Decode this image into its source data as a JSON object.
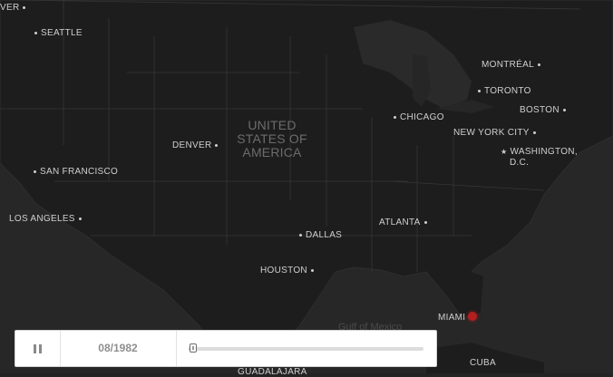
{
  "map": {
    "country_label": [
      "UNITED",
      "STATES OF",
      "AMERICA"
    ],
    "water_label": "Gulf of Mexico",
    "cities": [
      {
        "name": "VER",
        "marker": "dot"
      },
      {
        "name": "SEATTLE",
        "marker": "dot"
      },
      {
        "name": "MONTRÉAL",
        "marker": "dot"
      },
      {
        "name": "TORONTO",
        "marker": "dot"
      },
      {
        "name": "BOSTON",
        "marker": "dot"
      },
      {
        "name": "CHICAGO",
        "marker": "dot"
      },
      {
        "name": "NEW YORK CITY",
        "marker": "dot"
      },
      {
        "name": "WASHINGTON,",
        "marker": "star"
      },
      {
        "name": "D.C.",
        "marker": "none"
      },
      {
        "name": "DENVER",
        "marker": "dot"
      },
      {
        "name": "SAN FRANCISCO",
        "marker": "dot"
      },
      {
        "name": "LOS ANGELES",
        "marker": "dot"
      },
      {
        "name": "ATLANTA",
        "marker": "dot"
      },
      {
        "name": "DALLAS",
        "marker": "dot"
      },
      {
        "name": "HOUSTON",
        "marker": "dot"
      },
      {
        "name": "MIAMI",
        "marker": "dot"
      },
      {
        "name": "CUBA",
        "marker": "none"
      },
      {
        "name": "GUADALAJARA",
        "marker": "none"
      }
    ],
    "event_marker_color": "#b41e1e"
  },
  "player": {
    "state_icon": "pause-icon",
    "date": "08/1982",
    "progress": 0.02
  },
  "colors": {
    "land": "#1e1e1e",
    "ocean": "#272727",
    "border": "#3a3a3a"
  }
}
